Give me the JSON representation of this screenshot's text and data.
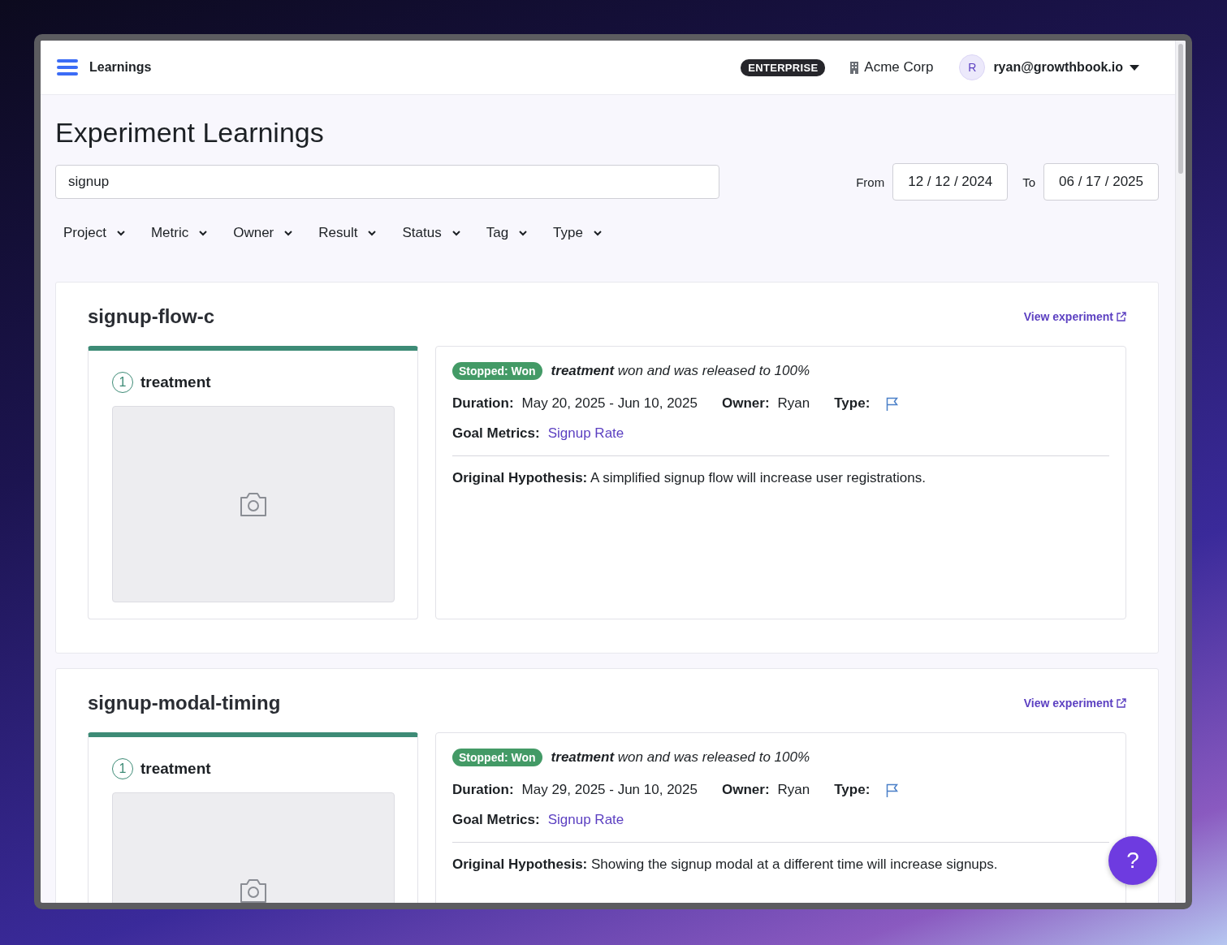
{
  "app": {
    "title": "Learnings"
  },
  "header": {
    "plan_badge": "ENTERPRISE",
    "organization": "Acme Corp",
    "user": {
      "avatar_initial": "R",
      "email": "ryan@growthbook.io"
    }
  },
  "page_title": "Experiment Learnings",
  "search": {
    "value": "signup"
  },
  "date_range": {
    "from_label": "From",
    "from": "12 / 12 / 2024",
    "to_label": "To",
    "to": "06 / 17 / 2025"
  },
  "filters": [
    "Project",
    "Metric",
    "Owner",
    "Result",
    "Status",
    "Tag",
    "Type"
  ],
  "experiments": [
    {
      "name": "signup-flow-c",
      "link": "View experiment",
      "variant": {
        "number": "1",
        "name": "treatment"
      },
      "status": "Stopped: Won",
      "summary": "**treatment** won and was released to 100%",
      "duration_label": "Duration:",
      "duration": "May 20, 2025 - Jun 10, 2025",
      "owner_label": "Owner:",
      "owner": "Ryan",
      "type_label": "Type:",
      "goal_label": "Goal Metrics:",
      "goal_metrics": [
        "Signup Rate"
      ],
      "hypothesis": "**Original Hypothesis:** A simplified signup flow will increase user registrations."
    },
    {
      "name": "signup-modal-timing",
      "link": "View experiment",
      "variant": {
        "number": "1",
        "name": "treatment"
      },
      "status": "Stopped: Won",
      "summary": "**treatment** won and was released to 100%",
      "duration_label": "Duration:",
      "duration": "May 29, 2025 - Jun 10, 2025",
      "owner_label": "Owner:",
      "owner": "Ryan",
      "type_label": "Type:",
      "goal_label": "Goal Metrics:",
      "goal_metrics": [
        "Signup Rate"
      ],
      "hypothesis": "**Original Hypothesis:** Showing the signup modal at a different time will increase signups."
    }
  ],
  "help_button": "?"
}
